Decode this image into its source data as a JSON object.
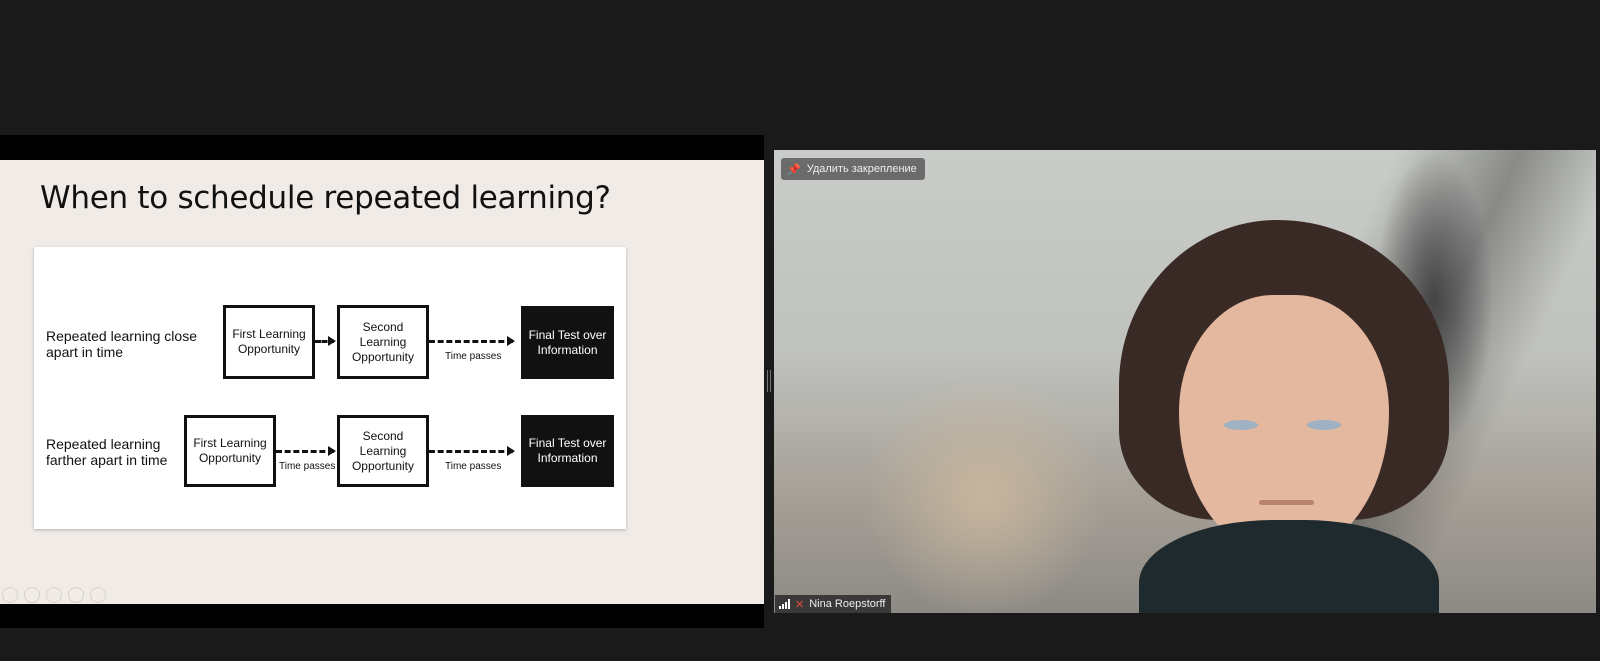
{
  "slide": {
    "title": "When to schedule repeated learning?",
    "row1": {
      "label_line1": "Repeated learning close",
      "label_line2": "apart in time",
      "box1": "First Learning Opportunity",
      "box2": "Second Learning Opportunity",
      "time_passes_1": "Time passes",
      "final": "Final Test over Information"
    },
    "row2": {
      "label_line1": "Repeated learning",
      "label_line2": "farther apart in time",
      "box1": "First Learning Opportunity",
      "time_passes_1": "Time passes",
      "box2": "Second Learning Opportunity",
      "time_passes_2": "Time passes",
      "final": "Final Test over Information"
    }
  },
  "video": {
    "unpin_label": "Удалить закрепление",
    "participant_name": "Nina Roepstorff",
    "icons": [
      "pin-icon",
      "signal-icon",
      "mic-muted-icon"
    ]
  }
}
